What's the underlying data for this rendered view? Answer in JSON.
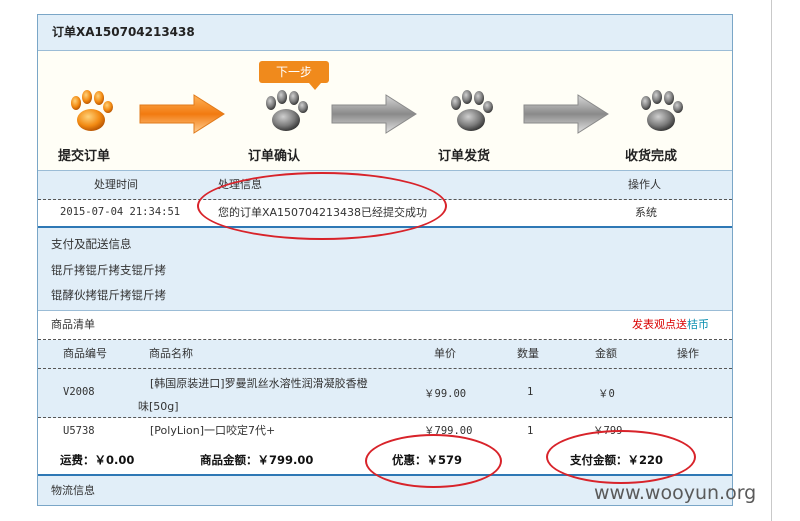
{
  "order": {
    "title": "订单XA150704213438"
  },
  "steps": {
    "next_label": "下一步",
    "items": [
      {
        "label": "提交订单",
        "icon": "paw-orange-icon"
      },
      {
        "label": "订单确认",
        "icon": "paw-gray-icon"
      },
      {
        "label": "订单发货",
        "icon": "paw-gray-icon"
      },
      {
        "label": "收货完成",
        "icon": "paw-gray-icon"
      }
    ]
  },
  "log": {
    "headers": {
      "time": "处理时间",
      "info": "处理信息",
      "operator": "操作人"
    },
    "rows": [
      {
        "time": "2015-07-04 21:34:51",
        "info": "您的订单XA150704213438已经提交成功",
        "operator": "系统"
      }
    ]
  },
  "payment": {
    "title": "支付及配送信息",
    "line1": "锟斤拷锟斤拷支锟斤拷",
    "line2": "锟酵伙拷锟斤拷锟斤拷"
  },
  "goods": {
    "title": "商品清单",
    "comment_link_red": "发表观点送",
    "comment_link_teal": "桔币",
    "columns": [
      "商品编号",
      "商品名称",
      "单价",
      "数量",
      "金额",
      "操作"
    ],
    "rows": [
      {
        "code": "V2008",
        "name_line1": "[韩国原装进口]罗曼凯丝水溶性润滑凝胶香橙",
        "name_line2": "味[50g]",
        "price": "￥99.00",
        "qty": "1",
        "amount": "￥0"
      },
      {
        "code": "U5738",
        "name_line1": "[PolyLion]一口咬定7代+",
        "name_line2": "",
        "price": "￥799.00",
        "qty": "1",
        "amount": "￥799"
      }
    ]
  },
  "totals": {
    "shipping": "运费：￥0.00",
    "goods_amount": "商品金额：￥799.00",
    "discount": "优惠：￥579",
    "pay_amount": "支付金额：￥220"
  },
  "logistics": {
    "title": "物流信息"
  },
  "watermark": "www.wooyun.org",
  "colors": {
    "accent_blue": "#2e78b5",
    "header_bg": "#e1eef8",
    "orange": "#f08a1c",
    "annotation_red": "#d8232a"
  }
}
